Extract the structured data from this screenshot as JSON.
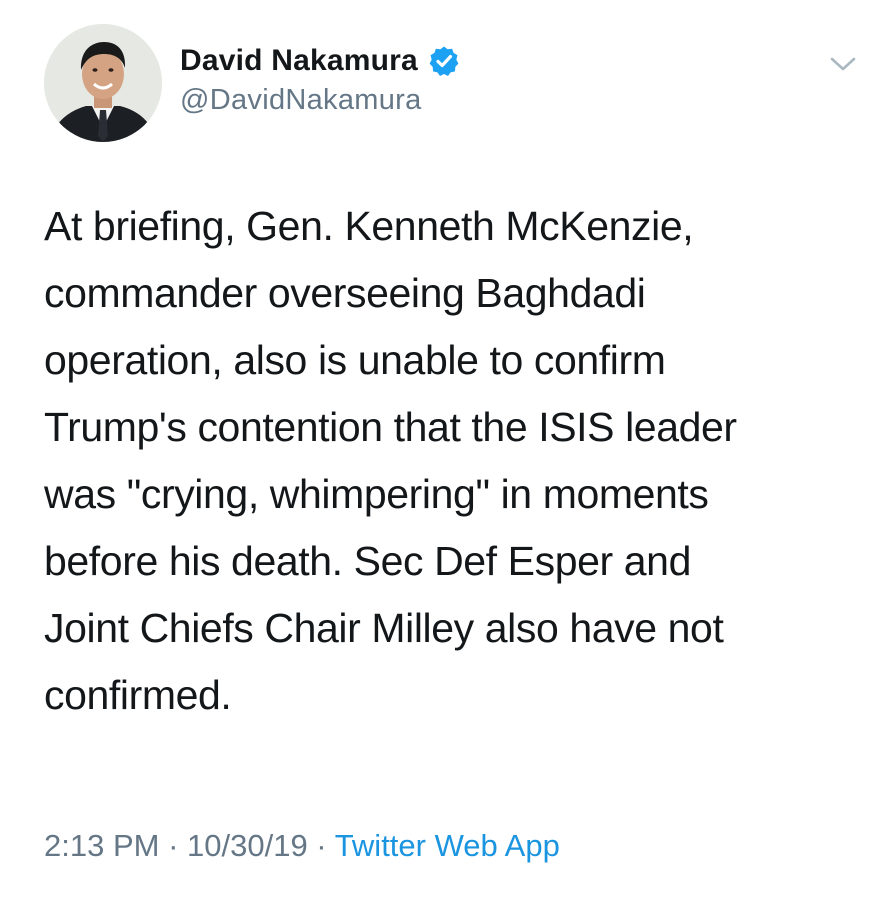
{
  "user": {
    "display_name": "David Nakamura",
    "handle": "@DavidNakamura",
    "verified": true,
    "avatar_icon": "profile-photo"
  },
  "tweet": {
    "text": "At briefing, Gen. Kenneth McKenzie,\ncommander overseeing Baghdadi\noperation, also is unable to confirm\nTrump's contention that the ISIS leader\nwas \"crying, whimpering\" in moments\nbefore his death. Sec Def Esper and\nJoint Chiefs Chair Milley also have not\nconfirmed.",
    "time": "2:13 PM",
    "separator": " · ",
    "date": "10/30/19",
    "source": "Twitter Web App"
  },
  "icons": {
    "verified": "verified-badge-icon",
    "menu": "chevron-down-icon"
  },
  "colors": {
    "text": "#14171a",
    "secondary": "#657786",
    "link": "#1b95e0",
    "verified": "#1da1f2",
    "background": "#ffffff"
  }
}
